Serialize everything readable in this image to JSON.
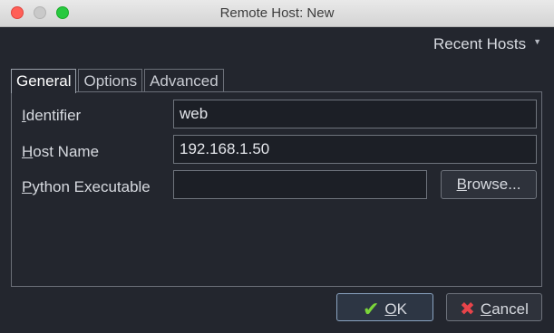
{
  "window": {
    "title": "Remote Host: New"
  },
  "recent_hosts": {
    "label": "Recent Hosts"
  },
  "tabs": [
    {
      "label": "General",
      "active": true
    },
    {
      "label": "Options",
      "active": false
    },
    {
      "label": "Advanced",
      "active": false
    }
  ],
  "form": {
    "identifier": {
      "label_first": "I",
      "label_rest": "dentifier",
      "value": "web"
    },
    "host_name": {
      "label_first": "H",
      "label_rest": "ost Name",
      "value": "192.168.1.50"
    },
    "python_executable": {
      "label_first": "P",
      "label_rest": "ython Executable",
      "value": ""
    },
    "browse_first": "B",
    "browse_rest": "rowse..."
  },
  "buttons": {
    "ok_first": "O",
    "ok_rest": "K",
    "cancel_first": "C",
    "cancel_rest": "ancel"
  },
  "icons": {
    "ok": "checkmark-icon",
    "cancel": "x-icon",
    "recent": "caret-down-icon"
  }
}
